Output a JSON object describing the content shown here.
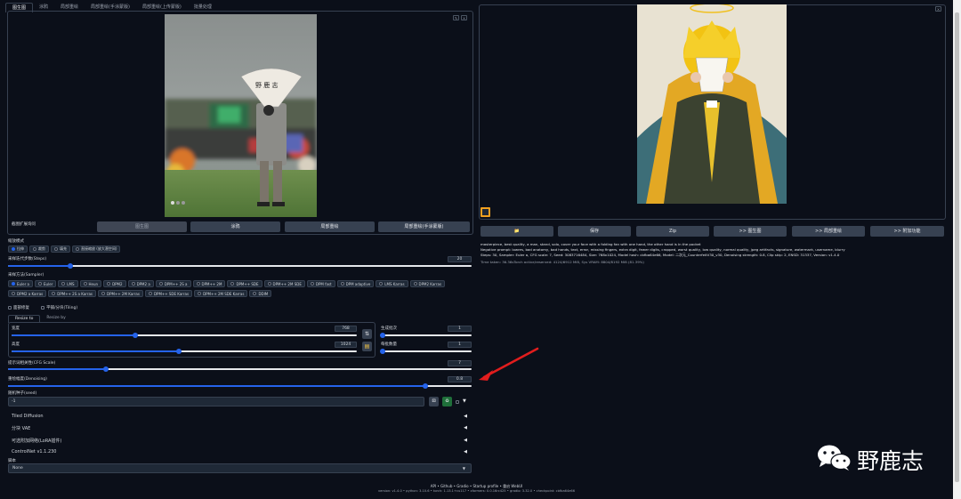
{
  "tabs": [
    "图生图",
    "涂鸦",
    "局部重绘",
    "局部重绘(手涂蒙版)",
    "局部重绘(上传蒙版)",
    "批量处理"
  ],
  "left": {
    "interrogate_label": "截图扩展询问",
    "copy_buttons": [
      "图生图",
      "涂鸦",
      "局部重绘",
      "局部重绘(手涂蒙版)"
    ],
    "resize_mode_label": "缩放模式",
    "resize_modes": [
      "拉伸",
      "裁剪",
      "填充",
      "直接缩放 (放大潜空间)"
    ],
    "steps_label": "采样迭代步数(Steps)",
    "steps_value": "20",
    "sampler_label": "采样方法(Sampler)",
    "samplers_row1": [
      "Euler a",
      "Euler",
      "LMS",
      "Heun",
      "DPM2",
      "DPM2 a",
      "DPM++ 2S a",
      "DPM++ 2M",
      "DPM++ SDE",
      "DPM++ 2M SDE",
      "DPM fast",
      "DPM adaptive",
      "LMS Karras",
      "DPM2 Karras",
      "DPM2 a Karras"
    ],
    "samplers_row2": [
      "DPM++ 2S a Karras",
      "DPM++ 2M Karras",
      "DPM++ SDE Karras",
      "DPM++ 2M SDE Karras",
      "DDIM"
    ],
    "restore_faces": "面部修复",
    "tiling": "平铺/分块(Tiling)",
    "resize_tabs": [
      "Resize to",
      "Resize by"
    ],
    "width_label": "宽度",
    "width_value": "768",
    "height_label": "高度",
    "height_value": "1024",
    "batch_count_label": "生成批次",
    "batch_count_value": "1",
    "batch_size_label": "每批数量",
    "batch_size_value": "1",
    "cfg_label": "提示词相关性(CFG Scale)",
    "cfg_value": "7",
    "denoise_label": "重绘幅度(Denoising)",
    "denoise_value": "0.8",
    "seed_label": "随机种子(seed)",
    "seed_value": "-1",
    "accordions": [
      "Tiled Diffusion",
      "分块 VAE",
      "可选附加网络(LoRA插件)",
      "ControlNet v1.1.230"
    ],
    "script_label": "脚本",
    "script_value": "None"
  },
  "right": {
    "action_buttons": [
      "📁",
      "保存",
      "Zip",
      ">> 图生图",
      ">> 局部重绘",
      ">> 附加功能"
    ],
    "info_prompt": "masterpiece, best quality, a man, stand, solo, cover your face with a folding fan with one hand, the other hand is in the pocket",
    "info_negative": "Negative prompt: lowres, bad anatomy, bad hands, text, error, missing fingers, extra digit, fewer digits, cropped, worst quality, low quality, normal quality, jpeg artifacts, signature, watermark, username, blurry",
    "info_params": "Steps: 30, Sampler: Euler a, CFG scale: 7, Seed: 3083716484, Size: 768x1024, Model hash: cbfba64e66, Model: 二次元_CounterfeitV30_v30, Denoising strength: 0.8, Clip skip: 2, ENSD: 31337, Version: v1.4.0",
    "time_taken": "Time taken: 36.36sTorch active/reserved: 4124/6912 MiB, Sys VRAM: 8804/8192 MiB (81.39%)"
  },
  "footer": {
    "links": "API  •  Github  •  Gradio  •  Startup profile  •  重启 WebUI",
    "versions": "version: v1.4.0  •  python: 3.10.6  •  torch: 1.13.1+cu117  •  xformers: 0.0.16rc425  •  gradio: 3.32.0  •  checkpoint: cbfba64e66"
  },
  "watermark": "野鹿志",
  "colors": {
    "bg": "#0b0f19",
    "accent": "#2563eb",
    "button": "#374151",
    "arrow": "#e11d1d"
  }
}
